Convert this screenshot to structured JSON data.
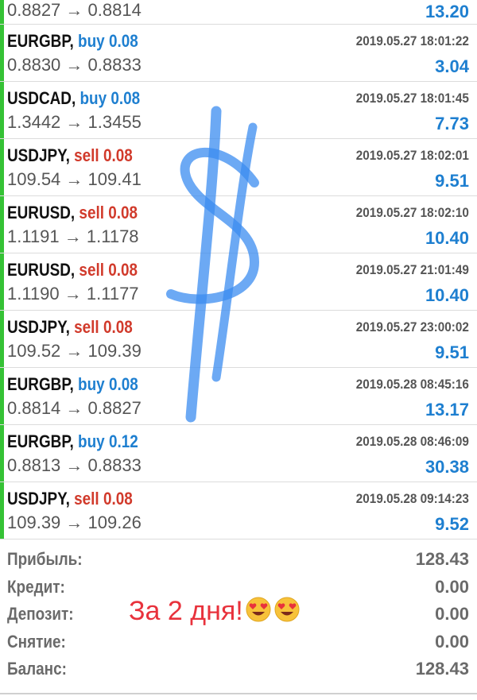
{
  "deals": [
    {
      "symbol": "",
      "side": "",
      "volume": "",
      "time": "",
      "price_open": "0.8827",
      "price_close": "0.8814",
      "profit": "13.20"
    },
    {
      "symbol": "EURGBP",
      "side": "buy",
      "volume": "0.08",
      "time": "2019.05.27 18:01:22",
      "price_open": "0.8830",
      "price_close": "0.8833",
      "profit": "3.04"
    },
    {
      "symbol": "USDCAD",
      "side": "buy",
      "volume": "0.08",
      "time": "2019.05.27 18:01:45",
      "price_open": "1.3442",
      "price_close": "1.3455",
      "profit": "7.73"
    },
    {
      "symbol": "USDJPY",
      "side": "sell",
      "volume": "0.08",
      "time": "2019.05.27 18:02:01",
      "price_open": "109.54",
      "price_close": "109.41",
      "profit": "9.51"
    },
    {
      "symbol": "EURUSD",
      "side": "sell",
      "volume": "0.08",
      "time": "2019.05.27 18:02:10",
      "price_open": "1.1191",
      "price_close": "1.1178",
      "profit": "10.40"
    },
    {
      "symbol": "EURUSD",
      "side": "sell",
      "volume": "0.08",
      "time": "2019.05.27 21:01:49",
      "price_open": "1.1190",
      "price_close": "1.1177",
      "profit": "10.40"
    },
    {
      "symbol": "USDJPY",
      "side": "sell",
      "volume": "0.08",
      "time": "2019.05.27 23:00:02",
      "price_open": "109.52",
      "price_close": "109.39",
      "profit": "9.51"
    },
    {
      "symbol": "EURGBP",
      "side": "buy",
      "volume": "0.08",
      "time": "2019.05.28 08:45:16",
      "price_open": "0.8814",
      "price_close": "0.8827",
      "profit": "13.17"
    },
    {
      "symbol": "EURGBP",
      "side": "buy",
      "volume": "0.12",
      "time": "2019.05.28 08:46:09",
      "price_open": "0.8813",
      "price_close": "0.8833",
      "profit": "30.38"
    },
    {
      "symbol": "USDJPY",
      "side": "sell",
      "volume": "0.08",
      "time": "2019.05.28 09:14:23",
      "price_open": "109.39",
      "price_close": "109.26",
      "profit": "9.52"
    }
  ],
  "summary": {
    "profit_label": "Прибыль:",
    "profit_value": "128.43",
    "credit_label": "Кредит:",
    "credit_value": "0.00",
    "deposit_label": "Депозит:",
    "deposit_value": "0.00",
    "withdrawal_label": "Снятие:",
    "withdrawal_value": "0.00",
    "balance_label": "Баланс:",
    "balance_value": "128.43"
  },
  "annotation": {
    "text": "За 2 дня!",
    "emoji": "heart-eyes-emoji"
  },
  "colors": {
    "buy": "#1e7fd0",
    "sell": "#d13a2b",
    "profit": "#1e7fd0",
    "status_bar": "#35c235",
    "annotation": "#e8323c",
    "dollar_drawing": "#3b8cf0"
  }
}
